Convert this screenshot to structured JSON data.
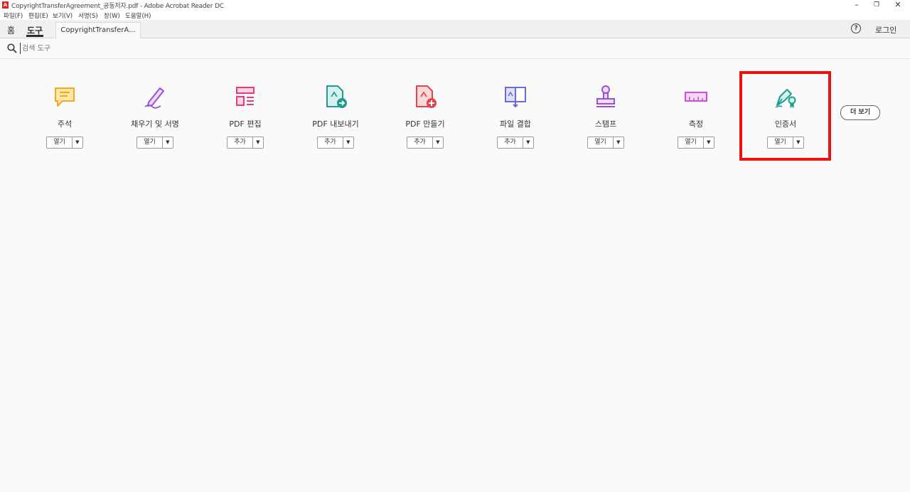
{
  "window": {
    "title": "CopyrightTransferAgreement_공동저자.pdf - Adobe Acrobat Reader DC",
    "app_icon": "acrobat-icon",
    "controls": [
      "minimize-icon",
      "restore-icon",
      "close-icon"
    ]
  },
  "menu": [
    "파일(F)",
    "편집(E)",
    "보기(V)",
    "서명(S)",
    "창(W)",
    "도움말(H)"
  ],
  "tabs": {
    "home": "홈",
    "tools": "도구",
    "document": "CopyrightTransferA...",
    "help_glyph": "?",
    "login": "로그인"
  },
  "search": {
    "placeholder": "검색 도구"
  },
  "tools": [
    {
      "label": "주석",
      "button": "열기",
      "icon": "comment-icon",
      "color": "#f5a623"
    },
    {
      "label": "채우기 및 서명",
      "button": "열기",
      "icon": "fill-sign-icon",
      "color": "#9b4fd8"
    },
    {
      "label": "PDF 편집",
      "button": "추가",
      "icon": "edit-pdf-icon",
      "color": "#e63c7f"
    },
    {
      "label": "PDF 내보내기",
      "button": "추가",
      "icon": "export-pdf-icon",
      "color": "#1f9b8f"
    },
    {
      "label": "PDF 만들기",
      "button": "추가",
      "icon": "create-pdf-icon",
      "color": "#e5434a"
    },
    {
      "label": "파일 결합",
      "button": "추가",
      "icon": "combine-files-icon",
      "color": "#6b6bd6"
    },
    {
      "label": "스탬프",
      "button": "열기",
      "icon": "stamp-icon",
      "color": "#9b4fd8"
    },
    {
      "label": "측정",
      "button": "열기",
      "icon": "measure-icon",
      "color": "#d04fd8"
    },
    {
      "label": "인증서",
      "button": "열기",
      "icon": "certificate-icon",
      "color": "#1f9b8f"
    }
  ],
  "more_button": "더 보기",
  "dropdown_glyph": "▼",
  "highlight_color": "#ee0f0f"
}
